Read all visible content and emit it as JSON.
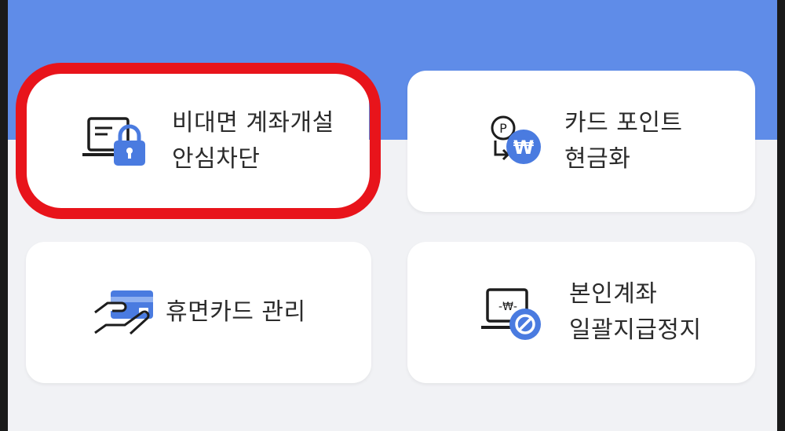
{
  "colors": {
    "accent": "#5f8ce8",
    "highlight": "#e8141b",
    "icon_blue": "#4a7be0",
    "icon_dark": "#1d1d1d"
  },
  "menu": {
    "items": [
      {
        "label_lines": [
          "비대면 계좌개설",
          "안심차단"
        ],
        "icon": "laptop-lock-icon",
        "highlighted": true
      },
      {
        "label_lines": [
          "카드 포인트",
          "현금화"
        ],
        "icon": "point-to-won-icon",
        "highlighted": false
      },
      {
        "label_lines": [
          "휴면카드 관리"
        ],
        "icon": "hand-card-icon",
        "highlighted": false
      },
      {
        "label_lines": [
          "본인계좌",
          "일괄지급정지"
        ],
        "icon": "laptop-block-icon",
        "highlighted": false
      }
    ]
  }
}
